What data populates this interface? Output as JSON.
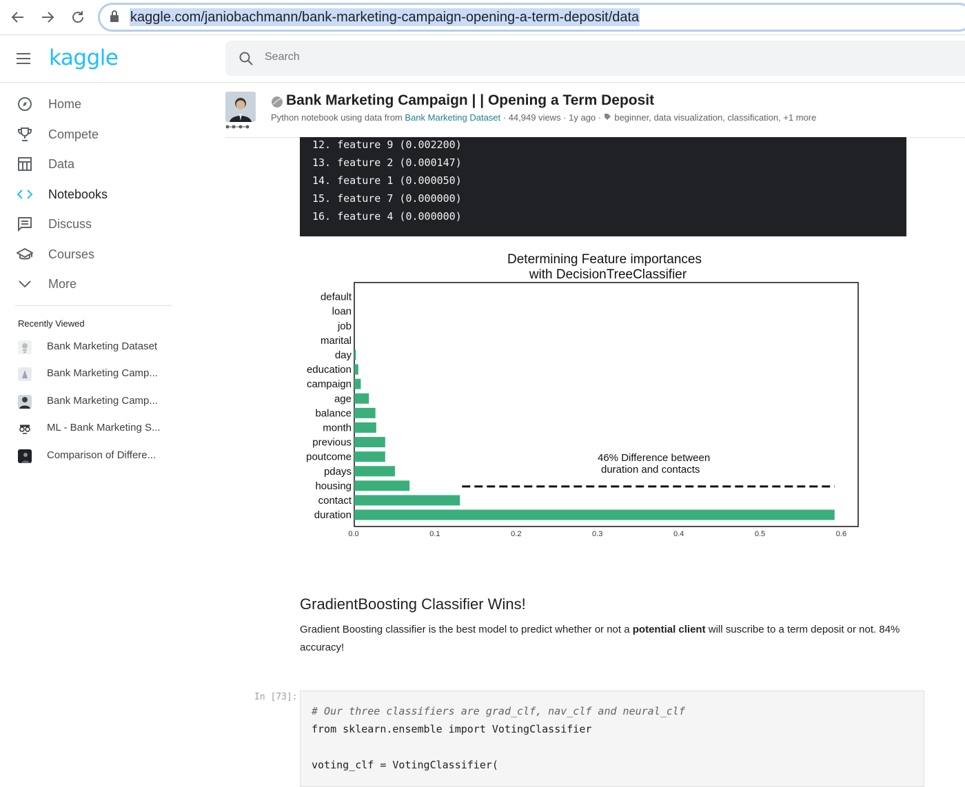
{
  "browser": {
    "url": "kaggle.com/janiobachmann/bank-marketing-campaign-opening-a-term-deposit/data"
  },
  "header": {
    "logo": "kaggle",
    "search_placeholder": "Search"
  },
  "sidebar": {
    "items": [
      {
        "label": "Home",
        "icon": "compass-icon"
      },
      {
        "label": "Compete",
        "icon": "trophy-icon"
      },
      {
        "label": "Data",
        "icon": "table-icon"
      },
      {
        "label": "Notebooks",
        "icon": "code-icon",
        "active": true
      },
      {
        "label": "Discuss",
        "icon": "comment-icon"
      },
      {
        "label": "Courses",
        "icon": "school-icon"
      },
      {
        "label": "More",
        "icon": "chevron-down-icon"
      }
    ],
    "recent_heading": "Recently Viewed",
    "recent": [
      {
        "label": "Bank Marketing Dataset"
      },
      {
        "label": "Bank Marketing Camp..."
      },
      {
        "label": "Bank Marketing Camp..."
      },
      {
        "label": "ML - Bank Marketing S..."
      },
      {
        "label": "Comparison of Differe..."
      }
    ]
  },
  "notebook": {
    "title": "Bank Marketing Campaign | | Opening a Term Deposit",
    "meta_prefix": "Python notebook using data from ",
    "meta_dataset": "Bank Marketing Dataset",
    "meta_stats": " · 44,949 views · 1y ago · ",
    "meta_tags": "beginner, data visualization, classification, +1 more"
  },
  "console": {
    "lines": [
      "12. feature 9 (0.002200)",
      "13. feature 2 (0.000147)",
      "14. feature 1 (0.000050)",
      "15. feature 7 (0.000000)",
      "16. feature 4 (0.000000)"
    ]
  },
  "chart_data": {
    "type": "bar",
    "orientation": "horizontal",
    "title_line1": "Determining Feature importances",
    "title_line2": "with DecisionTreeClassifier",
    "categories": [
      "default",
      "loan",
      "job",
      "marital",
      "day",
      "education",
      "campaign",
      "age",
      "balance",
      "month",
      "previous",
      "poutcome",
      "pdays",
      "housing",
      "contact",
      "duration"
    ],
    "values": [
      0.0,
      0.0,
      0.0,
      0.0,
      0.002,
      0.005,
      0.008,
      0.018,
      0.026,
      0.027,
      0.038,
      0.038,
      0.05,
      0.068,
      0.13,
      0.591
    ],
    "xlim": [
      0,
      0.62
    ],
    "xticks": [
      "0.0",
      "0.1",
      "0.2",
      "0.3",
      "0.4",
      "0.5",
      "0.6"
    ],
    "bar_color": "#3aaf7c",
    "annotation_line1": "46% Difference between",
    "annotation_line2": "duration and contacts",
    "dashed_line": {
      "from_x": 0.13,
      "to_x": 0.591
    },
    "grid": false
  },
  "markdown": {
    "heading": "GradientBoosting Classifier Wins!",
    "para_before": "Gradient Boosting classifier is the best model to predict whether or not a ",
    "para_bold": "potential client",
    "para_after": " will suscribe to a term deposit or not. 84% accuracy!"
  },
  "code_cell": {
    "prompt": "In [73]:",
    "lines": [
      "# Our three classifiers are grad_clf, nav_clf and neural_clf",
      "from sklearn.ensemble import VotingClassifier",
      "",
      "voting_clf = VotingClassifier("
    ]
  }
}
